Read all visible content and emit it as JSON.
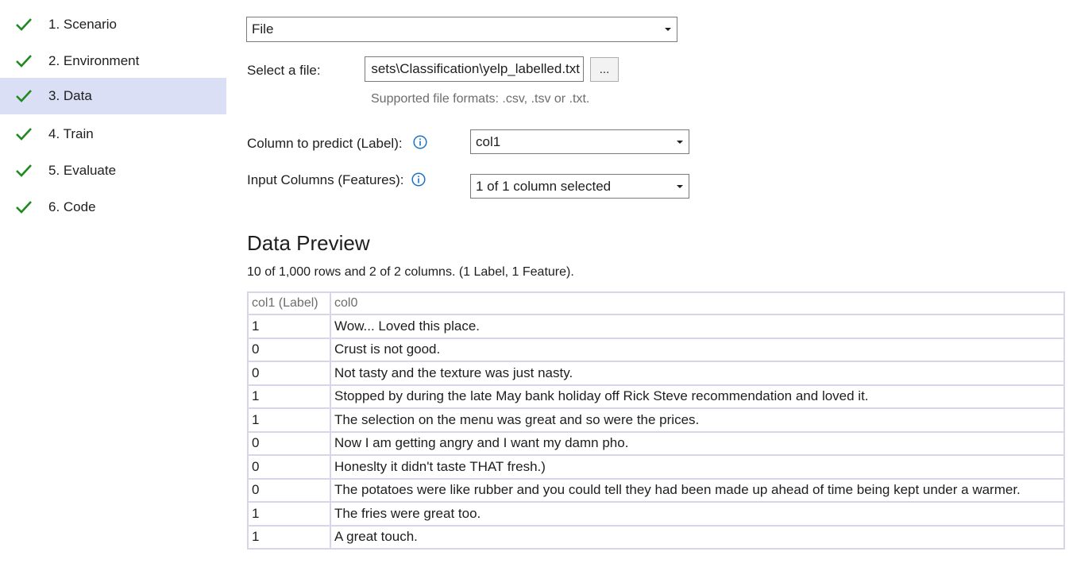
{
  "sidebar": {
    "steps": [
      {
        "label": "1. Scenario"
      },
      {
        "label": "2. Environment"
      },
      {
        "label": "3. Data"
      },
      {
        "label": "4. Train"
      },
      {
        "label": "5. Evaluate"
      },
      {
        "label": "6. Code"
      }
    ],
    "active_step": "3. Data",
    "check_color": "#1f8a1f",
    "active_bg": "#dadff6"
  },
  "data_source": {
    "selected": "File"
  },
  "file_select": {
    "label": "Select a file:",
    "value": "sets\\Classification\\yelp_labelled.txt",
    "browse_label": "...",
    "hint": "Supported file formats: .csv, .tsv or .txt."
  },
  "label_column": {
    "label": "Column to predict (Label):",
    "selected": "col1"
  },
  "feature_columns": {
    "label": "Input Columns (Features):",
    "selected": "1 of 1 column selected"
  },
  "preview": {
    "title": "Data Preview",
    "summary": "10 of 1,000 rows and 2 of 2 columns. (1 Label, 1 Feature).",
    "columns": [
      "col1 (Label)",
      "col0"
    ],
    "rows": [
      [
        "1",
        "Wow... Loved this place."
      ],
      [
        "0",
        "Crust is not good."
      ],
      [
        "0",
        "Not tasty and the texture was just nasty."
      ],
      [
        "1",
        "Stopped by during the late May bank holiday off Rick Steve recommendation and loved it."
      ],
      [
        "1",
        "The selection on the menu was great and so were the prices."
      ],
      [
        "0",
        "Now I am getting angry and I want my damn pho."
      ],
      [
        "0",
        "Honeslty it didn't taste THAT fresh.)"
      ],
      [
        "0",
        "The potatoes were like rubber and you could tell they had been made up ahead of time being kept under a warmer."
      ],
      [
        "1",
        "The fries were great too."
      ],
      [
        "1",
        "A great touch."
      ]
    ]
  },
  "icons": {
    "step_status": "check-icon",
    "info": "info-icon",
    "dropdown": "chevron-down-icon"
  },
  "colors": {
    "info_icon": "#1a73c8",
    "hint_text": "#6d6d6d",
    "table_border": "#d6d6e8"
  }
}
